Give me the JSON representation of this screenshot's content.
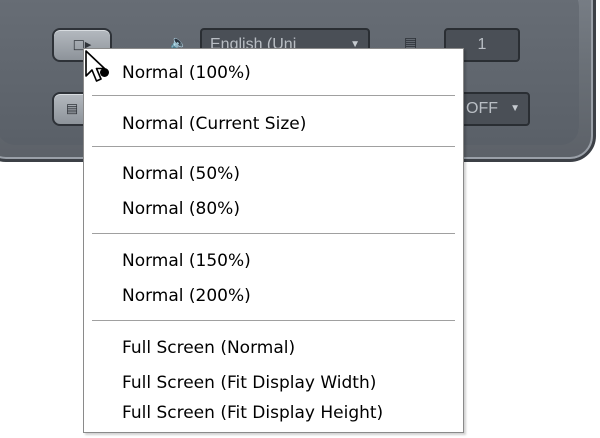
{
  "player": {
    "language_value": "English (Uni",
    "counter_value": "1",
    "toggle_value": "OFF",
    "icons": {
      "view_button": "screen-arrow-icon",
      "list_button": "list-icon",
      "audio": "speaker-icon",
      "subtitle": "subtitle-icon"
    }
  },
  "menu": {
    "items": [
      {
        "label": "Normal (100%)",
        "checked": true
      },
      {
        "label": "Normal (Current Size)",
        "checked": false
      },
      {
        "label": "Normal (50%)",
        "checked": false
      },
      {
        "label": "Normal (80%)",
        "checked": false
      },
      {
        "label": "Normal (150%)",
        "checked": false
      },
      {
        "label": "Normal (200%)",
        "checked": false
      },
      {
        "label": "Full Screen (Normal)",
        "checked": false
      },
      {
        "label": "Full Screen (Fit Display Width)",
        "checked": false
      },
      {
        "label": "Full Screen (Fit Display Height)",
        "checked": false
      }
    ]
  },
  "colors": {
    "panel": "#6a7077",
    "field": "#4a4f56",
    "field_text": "#b9bec4",
    "menu_bg": "#ffffff",
    "menu_border": "#8a8a8a"
  }
}
